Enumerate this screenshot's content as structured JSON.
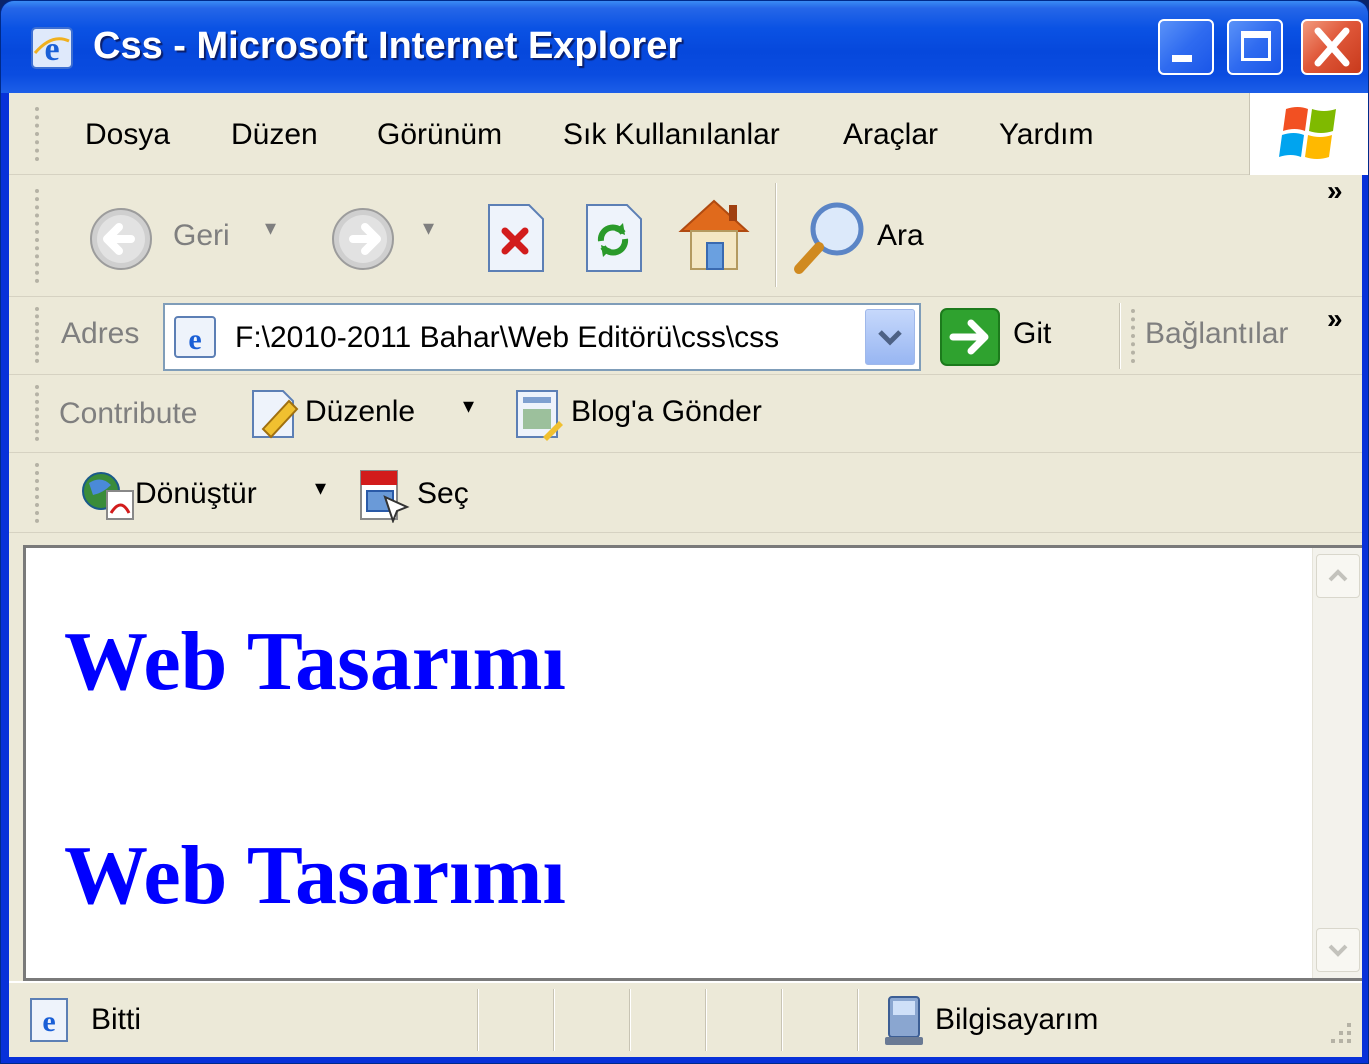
{
  "window": {
    "title": "Css - Microsoft Internet Explorer"
  },
  "menu": {
    "items": [
      "Dosya",
      "Düzen",
      "Görünüm",
      "Sık Kullanılanlar",
      "Araçlar",
      "Yardım"
    ]
  },
  "toolbar": {
    "back_label": "Geri",
    "search_label": "Ara",
    "chevron": "»"
  },
  "address": {
    "label": "Adres",
    "value": "F:\\2010-2011 Bahar\\Web Editörü\\css\\css",
    "go_label": "Git",
    "links_label": "Bağlantılar"
  },
  "contribute": {
    "label": "Contribute",
    "edit_label": "Düzenle",
    "blog_label": "Blog'a Gönder"
  },
  "pdf": {
    "convert_label": "Dönüştür",
    "select_label": "Seç"
  },
  "page": {
    "headings": [
      "Web Tasarımı",
      "Web Tasarımı"
    ],
    "heading_color": "#0000ff"
  },
  "status": {
    "text": "Bitti",
    "zone": "Bilgisayarım"
  }
}
